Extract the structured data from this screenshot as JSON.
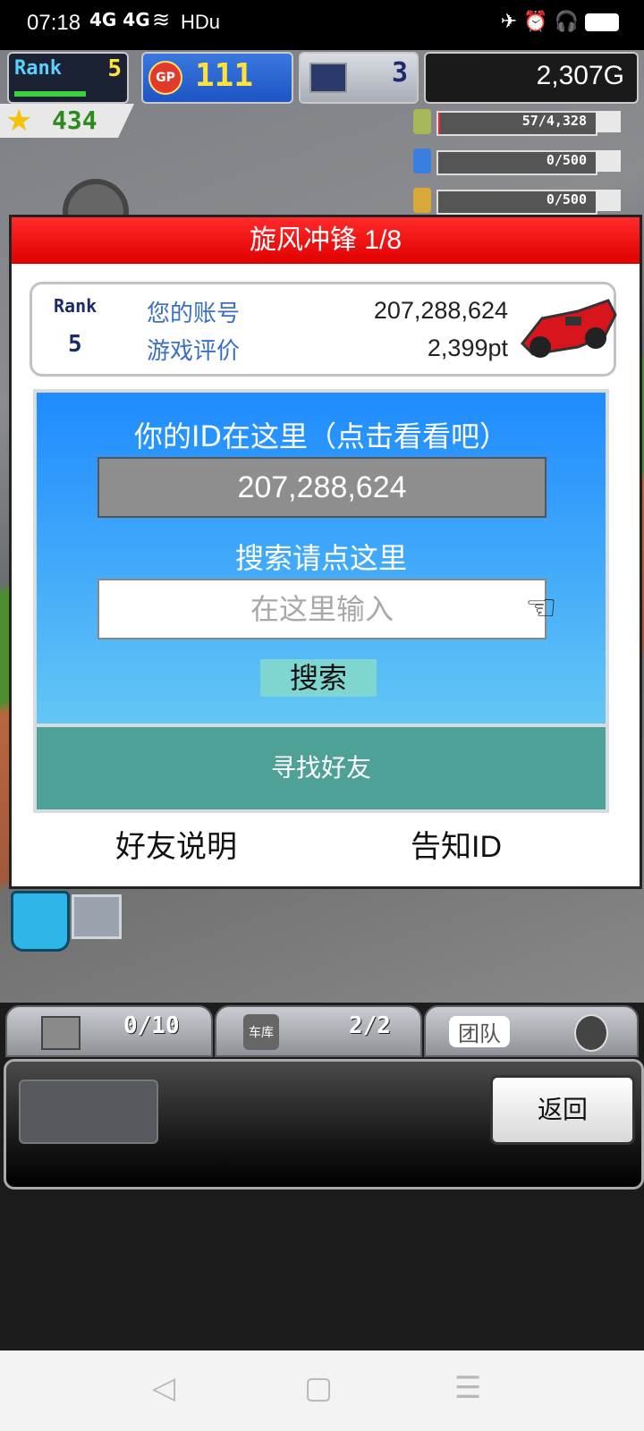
{
  "status_bar": {
    "time": "07:18",
    "signal": "4G 4G",
    "network": "HDu"
  },
  "hud": {
    "rank_label": "Rank",
    "rank_value": "5",
    "gp_label": "GP",
    "gp_value": "111",
    "pc_value": "3",
    "gold": "2,307G",
    "stars": "434",
    "resources": [
      {
        "value": "57/4,328",
        "fill": 0.01
      },
      {
        "value": "0/500",
        "fill": 0
      },
      {
        "value": "0/500",
        "fill": 0
      }
    ]
  },
  "dialog": {
    "title": "旋风冲锋 1/8",
    "info": {
      "rank_label": "Rank",
      "rank_value": "5",
      "account_label": "您的账号",
      "account_value": "207,288,624",
      "rating_label": "游戏评价",
      "rating_value": "2,399pt"
    },
    "id_hint": "你的ID在这里（点击看看吧）",
    "id_value": "207,288,624",
    "search_hint": "搜索请点这里",
    "search_placeholder": "在这里输入",
    "search_button": "搜索",
    "find_friend": "寻找好友",
    "friend_help": "好友说明",
    "tell_id": "告知ID"
  },
  "bottom": {
    "tab1_value": "0/10",
    "tab2_label": "车库",
    "tab2_value": "2/2",
    "tab3_label": "团队",
    "back": "返回"
  },
  "nav": {
    "back": "◁",
    "home": "▢",
    "menu": "☰"
  }
}
